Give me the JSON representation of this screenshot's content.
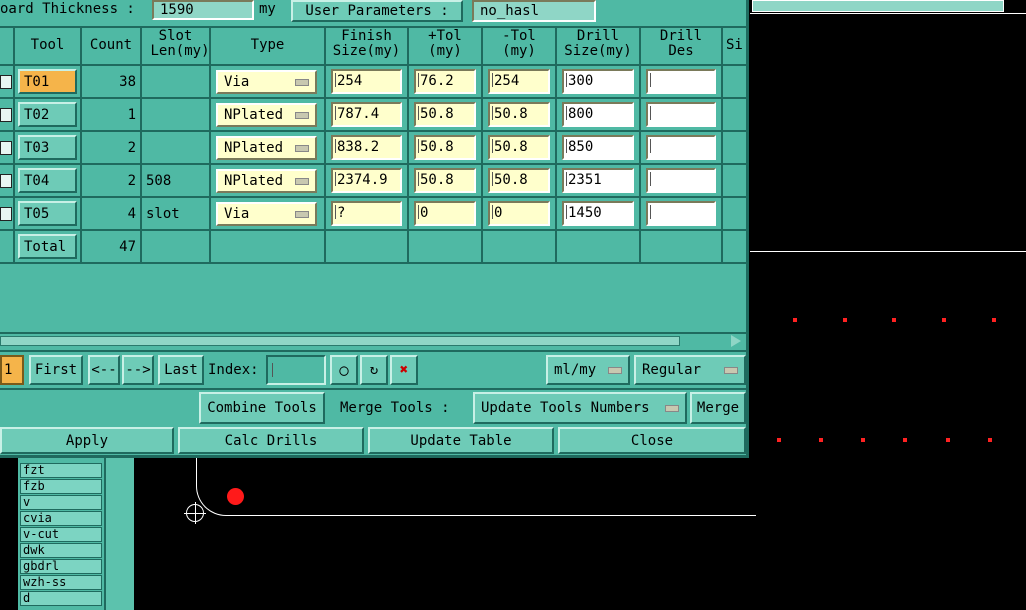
{
  "header": {
    "thickness_label": "oard Thickness :",
    "thickness_value": "1590",
    "unit": "my",
    "user_params_label": "User Parameters :",
    "user_params_value": "no_hasl"
  },
  "table": {
    "columns": [
      "Tool",
      "Count",
      "Slot Len(my)",
      "Type",
      "Finish Size(my)",
      "+Tol (my)",
      "-Tol (my)",
      "Drill Size(my)",
      "Drill Des",
      "Si"
    ],
    "rows": [
      {
        "tool": "T01",
        "count": "38",
        "slot": "",
        "type": "Via",
        "finish": "254",
        "ptol": "76.2",
        "ntol": "254",
        "drill": "300",
        "des": ""
      },
      {
        "tool": "T02",
        "count": "1",
        "slot": "",
        "type": "NPlated",
        "finish": "787.4",
        "ptol": "50.8",
        "ntol": "50.8",
        "drill": "800",
        "des": ""
      },
      {
        "tool": "T03",
        "count": "2",
        "slot": "",
        "type": "NPlated",
        "finish": "838.2",
        "ptol": "50.8",
        "ntol": "50.8",
        "drill": "850",
        "des": ""
      },
      {
        "tool": "T04",
        "count": "2",
        "slot": "508",
        "type": "NPlated",
        "finish": "2374.9",
        "ptol": "50.8",
        "ntol": "50.8",
        "drill": "2351",
        "des": ""
      },
      {
        "tool": "T05",
        "count": "4",
        "slot": "slot",
        "type": "Via",
        "finish": "?",
        "ptol": "0",
        "ntol": "0",
        "drill": "1450",
        "des": ""
      }
    ],
    "total": {
      "label": "Total",
      "count": "47"
    }
  },
  "nav": {
    "page_value": "1",
    "first": "First",
    "prev": "<--",
    "next": "-->",
    "last": "Last",
    "index_label": "Index:",
    "units_select": "ml/my",
    "mode_select": "Regular"
  },
  "actions": {
    "combine": "Combine Tools",
    "merge_label": "Merge Tools :",
    "update_numbers": "Update Tools Numbers",
    "merge": "Merge",
    "apply": "Apply",
    "calc": "Calc Drills",
    "update_table": "Update Table",
    "close": "Close"
  },
  "layers": [
    "fzt",
    "fzb",
    "v",
    "cvia",
    "v-cut",
    "dwk",
    "gbdrl",
    "wzh-ss",
    "d"
  ],
  "colors": {
    "panel": "#4fb9a4",
    "field": "#ffffcc",
    "selected": "#f5b44a",
    "drill_marks": "#ff2222"
  }
}
